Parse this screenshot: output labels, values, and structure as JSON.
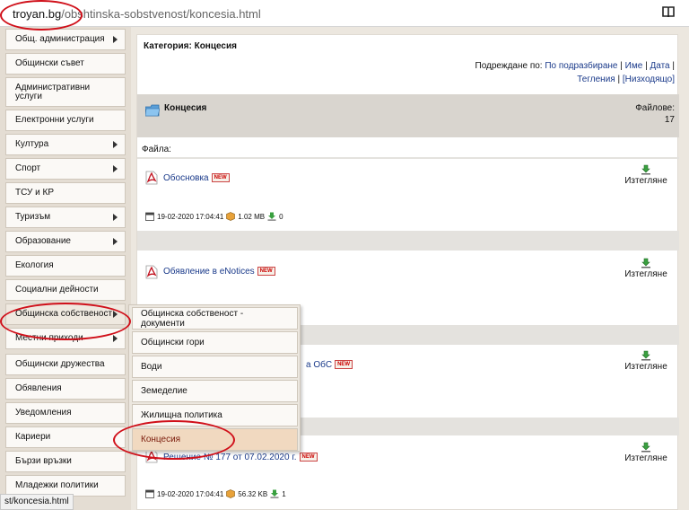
{
  "browser": {
    "url_domain": "troyan.bg",
    "url_path": "/obshtinska-sobstvenost/koncesia.html",
    "status_url": "st/koncesia.html"
  },
  "sidebar": {
    "items": [
      {
        "label": "Общ. администрация",
        "arrow": true
      },
      {
        "label": "Общински съвет",
        "arrow": false
      },
      {
        "label": "Административни услуги",
        "arrow": false
      },
      {
        "label": "Електронни услуги",
        "arrow": false
      },
      {
        "label": "Култура",
        "arrow": true
      },
      {
        "label": "Спорт",
        "arrow": true
      },
      {
        "label": "ТСУ и КР",
        "arrow": false
      },
      {
        "label": "Туризъм",
        "arrow": true
      },
      {
        "label": "Образование",
        "arrow": true
      },
      {
        "label": "Екология",
        "arrow": false
      },
      {
        "label": "Социални дейности",
        "arrow": false
      },
      {
        "label": "Общинска собственост",
        "arrow": true
      },
      {
        "label": "Местни приходи",
        "arrow": true
      },
      {
        "label": "Общински дружества",
        "arrow": false
      },
      {
        "label": "Обявления",
        "arrow": false
      },
      {
        "label": "Уведомления",
        "arrow": false
      },
      {
        "label": "Кариери",
        "arrow": false
      },
      {
        "label": "Бързи връзки",
        "arrow": false
      },
      {
        "label": "Младежки политики",
        "arrow": false
      }
    ]
  },
  "submenu": {
    "items": [
      {
        "label": "Общинска собственост - документи"
      },
      {
        "label": "Общински гори"
      },
      {
        "label": "Води"
      },
      {
        "label": "Земеделие"
      },
      {
        "label": "Жилищна политика"
      },
      {
        "label": "Концесия"
      }
    ]
  },
  "main": {
    "category_title": "Категория: Концесия",
    "sort_prefix": "Подреждане по:",
    "sort_default": "По подразбиране",
    "sort_name": "Име",
    "sort_date": "Дата",
    "sort_downloads": "Тегления",
    "sort_desc": "[Низходящо]",
    "sep": "|",
    "folder_name": "Концесия",
    "files_label": "Файлове:",
    "files_count": "17",
    "files_heading": "Файла:",
    "download_label": "Изтегляне",
    "new_badge": "NEW",
    "files": [
      {
        "name": "Обосновка",
        "date": "19-02-2020 17:04:41",
        "size": "1.02 MB",
        "downloads": "0"
      },
      {
        "name": "Обявление в eNotices",
        "date": "",
        "size": "",
        "downloads": ""
      },
      {
        "name": "а ОбС",
        "date": "",
        "size": "",
        "downloads": ""
      },
      {
        "name": "Решение № 177 от 07.02.2020 г.",
        "date": "19-02-2020 17:04:41",
        "size": "56.32 KB",
        "downloads": "1"
      }
    ]
  },
  "colors": {
    "annotation": "#d0101a",
    "link": "#1a3a8a",
    "sidebar_bg": "#e4ddd3"
  }
}
